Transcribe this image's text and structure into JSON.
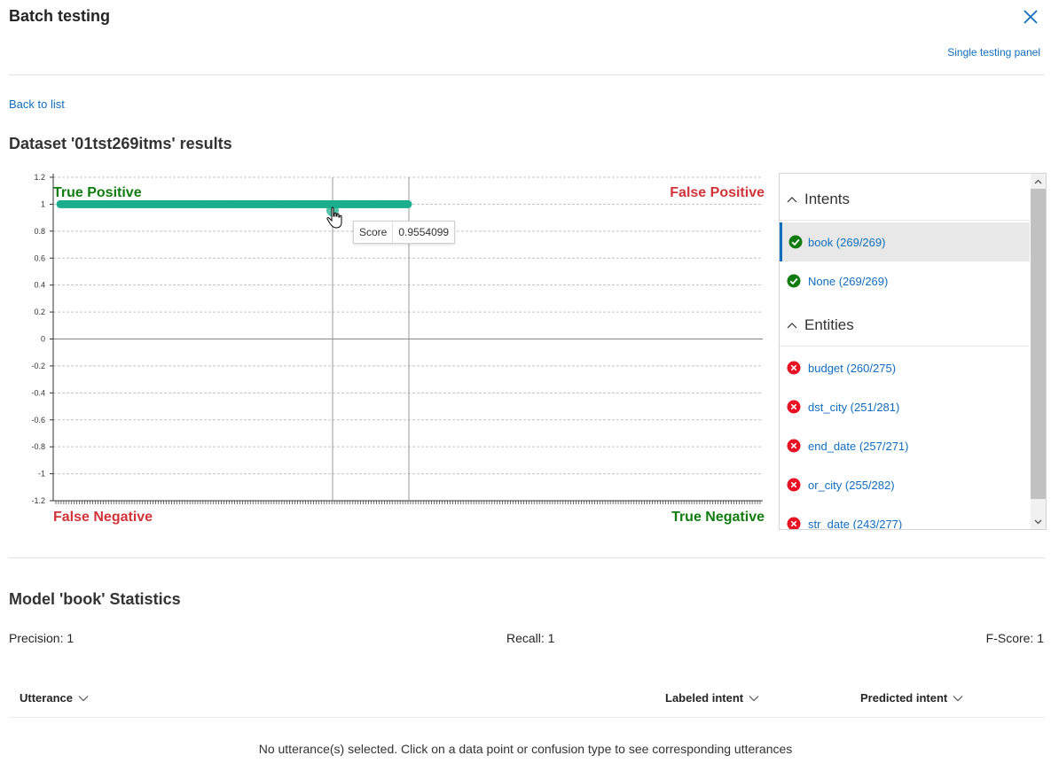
{
  "header": {
    "title": "Batch testing",
    "single_link": "Single testing panel"
  },
  "nav": {
    "back": "Back to list"
  },
  "dataset": {
    "title": "Dataset '01tst269itms' results"
  },
  "chart_data": {
    "type": "scatter",
    "ylim": [
      -1.2,
      1.2
    ],
    "yticks": [
      "1.2",
      "1",
      "0.8",
      "0.6",
      "0.4",
      "0.2",
      "0",
      "-0.2",
      "-0.4",
      "-0.6",
      "-0.8",
      "-1",
      "-1.2"
    ],
    "quadrant_labels": {
      "top_left": "True Positive",
      "top_right": "False Positive",
      "bottom_left": "False Negative",
      "bottom_right": "True Negative"
    },
    "points_y": 1,
    "point_count": 269,
    "hover": {
      "label": "Score",
      "value": "0.9554099"
    },
    "grid": true
  },
  "colors": {
    "accent": "#106ebe",
    "positive": "#107c10",
    "negative": "#d13438",
    "point": "#1aae8c"
  },
  "panel": {
    "intents_label": "Intents",
    "entities_label": "Entities",
    "intents": [
      {
        "label": "book (269/269)",
        "status": "check-icon"
      },
      {
        "label": "None (269/269)",
        "status": "check-icon"
      }
    ],
    "entities": [
      {
        "label": "budget (260/275)",
        "status": "error-icon"
      },
      {
        "label": "dst_city (251/281)",
        "status": "error-icon"
      },
      {
        "label": "end_date (257/271)",
        "status": "error-icon"
      },
      {
        "label": "or_city (255/282)",
        "status": "error-icon"
      },
      {
        "label": "str_date (243/277)",
        "status": "error-icon"
      }
    ]
  },
  "stats": {
    "title": "Model 'book' Statistics",
    "precision": "Precision: 1",
    "recall": "Recall: 1",
    "fscore": "F-Score: 1"
  },
  "table": {
    "columns": [
      "Utterance",
      "Labeled intent",
      "Predicted intent"
    ],
    "empty": "No utterance(s) selected. Click on a data point or confusion type to see corresponding utterances"
  }
}
